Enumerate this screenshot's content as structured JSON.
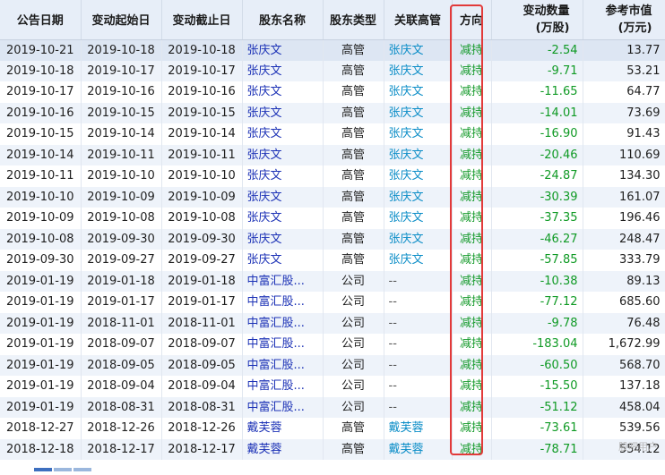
{
  "table": {
    "headers": {
      "announce_date": "公告日期",
      "change_start": "变动起始日",
      "change_end": "变动截止日",
      "holder_name": "股东名称",
      "holder_type": "股东类型",
      "related_exec": "关联高管",
      "direction": "方向",
      "change_qty_1": "变动数量",
      "change_qty_2": "(万股)",
      "ref_value_1": "参考市值",
      "ref_value_2": "(万元)"
    },
    "rows": [
      {
        "announce": "2019-10-21",
        "start": "2019-10-18",
        "end": "2019-10-18",
        "holder": "张庆文",
        "type": "高管",
        "exec": "张庆文",
        "dir": "减持",
        "qty": "-2.54",
        "value": "13.77"
      },
      {
        "announce": "2019-10-18",
        "start": "2019-10-17",
        "end": "2019-10-17",
        "holder": "张庆文",
        "type": "高管",
        "exec": "张庆文",
        "dir": "减持",
        "qty": "-9.71",
        "value": "53.21"
      },
      {
        "announce": "2019-10-17",
        "start": "2019-10-16",
        "end": "2019-10-16",
        "holder": "张庆文",
        "type": "高管",
        "exec": "张庆文",
        "dir": "减持",
        "qty": "-11.65",
        "value": "64.77"
      },
      {
        "announce": "2019-10-16",
        "start": "2019-10-15",
        "end": "2019-10-15",
        "holder": "张庆文",
        "type": "高管",
        "exec": "张庆文",
        "dir": "减持",
        "qty": "-14.01",
        "value": "73.69"
      },
      {
        "announce": "2019-10-15",
        "start": "2019-10-14",
        "end": "2019-10-14",
        "holder": "张庆文",
        "type": "高管",
        "exec": "张庆文",
        "dir": "减持",
        "qty": "-16.90",
        "value": "91.43"
      },
      {
        "announce": "2019-10-14",
        "start": "2019-10-11",
        "end": "2019-10-11",
        "holder": "张庆文",
        "type": "高管",
        "exec": "张庆文",
        "dir": "减持",
        "qty": "-20.46",
        "value": "110.69"
      },
      {
        "announce": "2019-10-11",
        "start": "2019-10-10",
        "end": "2019-10-10",
        "holder": "张庆文",
        "type": "高管",
        "exec": "张庆文",
        "dir": "减持",
        "qty": "-24.87",
        "value": "134.30"
      },
      {
        "announce": "2019-10-10",
        "start": "2019-10-09",
        "end": "2019-10-09",
        "holder": "张庆文",
        "type": "高管",
        "exec": "张庆文",
        "dir": "减持",
        "qty": "-30.39",
        "value": "161.07"
      },
      {
        "announce": "2019-10-09",
        "start": "2019-10-08",
        "end": "2019-10-08",
        "holder": "张庆文",
        "type": "高管",
        "exec": "张庆文",
        "dir": "减持",
        "qty": "-37.35",
        "value": "196.46"
      },
      {
        "announce": "2019-10-08",
        "start": "2019-09-30",
        "end": "2019-09-30",
        "holder": "张庆文",
        "type": "高管",
        "exec": "张庆文",
        "dir": "减持",
        "qty": "-46.27",
        "value": "248.47"
      },
      {
        "announce": "2019-09-30",
        "start": "2019-09-27",
        "end": "2019-09-27",
        "holder": "张庆文",
        "type": "高管",
        "exec": "张庆文",
        "dir": "减持",
        "qty": "-57.85",
        "value": "333.79"
      },
      {
        "announce": "2019-01-19",
        "start": "2019-01-18",
        "end": "2019-01-18",
        "holder": "中富汇股...",
        "type": "公司",
        "exec": "--",
        "dir": "减持",
        "qty": "-10.38",
        "value": "89.13"
      },
      {
        "announce": "2019-01-19",
        "start": "2019-01-17",
        "end": "2019-01-17",
        "holder": "中富汇股...",
        "type": "公司",
        "exec": "--",
        "dir": "减持",
        "qty": "-77.12",
        "value": "685.60"
      },
      {
        "announce": "2019-01-19",
        "start": "2018-11-01",
        "end": "2018-11-01",
        "holder": "中富汇股...",
        "type": "公司",
        "exec": "--",
        "dir": "减持",
        "qty": "-9.78",
        "value": "76.48"
      },
      {
        "announce": "2019-01-19",
        "start": "2018-09-07",
        "end": "2018-09-07",
        "holder": "中富汇股...",
        "type": "公司",
        "exec": "--",
        "dir": "减持",
        "qty": "-183.04",
        "value": "1,672.99"
      },
      {
        "announce": "2019-01-19",
        "start": "2018-09-05",
        "end": "2018-09-05",
        "holder": "中富汇股...",
        "type": "公司",
        "exec": "--",
        "dir": "减持",
        "qty": "-60.50",
        "value": "568.70"
      },
      {
        "announce": "2019-01-19",
        "start": "2018-09-04",
        "end": "2018-09-04",
        "holder": "中富汇股...",
        "type": "公司",
        "exec": "--",
        "dir": "减持",
        "qty": "-15.50",
        "value": "137.18"
      },
      {
        "announce": "2019-01-19",
        "start": "2018-08-31",
        "end": "2018-08-31",
        "holder": "中富汇股...",
        "type": "公司",
        "exec": "--",
        "dir": "减持",
        "qty": "-51.12",
        "value": "458.04"
      },
      {
        "announce": "2018-12-27",
        "start": "2018-12-26",
        "end": "2018-12-26",
        "holder": "戴芙蓉",
        "type": "高管",
        "exec": "戴芙蓉",
        "dir": "减持",
        "qty": "-73.61",
        "value": "539.56"
      },
      {
        "announce": "2018-12-18",
        "start": "2018-12-17",
        "end": "2018-12-17",
        "holder": "戴芙蓉",
        "type": "高管",
        "exec": "戴芙蓉",
        "dir": "减持",
        "qty": "-78.71",
        "value": "554.12"
      }
    ]
  },
  "watermark": "股吧用户",
  "colors": {
    "header_bg": "#e7eef8",
    "stripe_bg": "#eef3fa",
    "holder_link": "#1c32b6",
    "exec_link": "#0b8dc7",
    "negative_green": "#0f9a24",
    "highlight_red": "#e23a3a"
  }
}
